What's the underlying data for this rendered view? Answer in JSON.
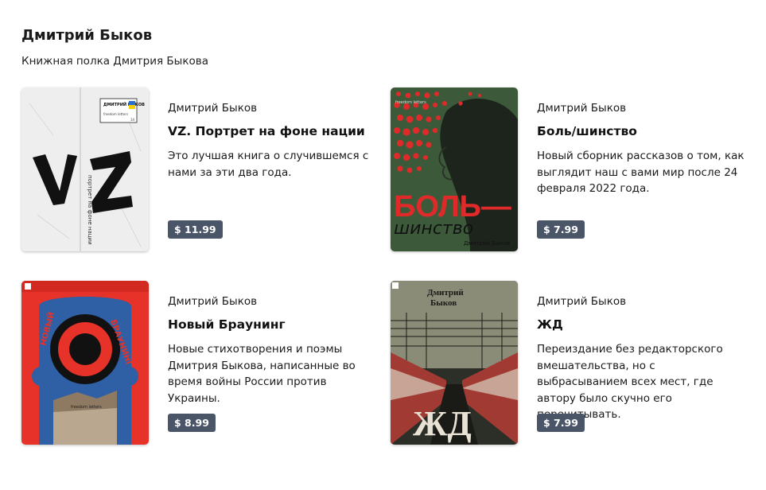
{
  "page": {
    "title": "Дмитрий Быков",
    "subtitle": "Книжная полка Дмитрия Быкова"
  },
  "books": [
    {
      "author": "Дмитрий Быков",
      "title": "VZ. Портрет на фоне нации",
      "description": "Это лучшая книга о случившемся с нами за эти два года.",
      "price": "$ 11.99",
      "cover_text": [
        "VZ",
        "ДМИТРИЙ БЫКОВ",
        "freedom letters",
        "портрет на фоне нации",
        "34"
      ]
    },
    {
      "author": "Дмитрий Быков",
      "title": "Боль/шинство",
      "description": "Новый сборник рассказов о том, как выглядит наш с вами мир после 24 февраля 2022 года.",
      "price": "$ 7.99",
      "cover_text": [
        "БОЛЬ—",
        "шинство",
        "Дмитрий Быков",
        "freedom letters"
      ]
    },
    {
      "author": "Дмитрий Быков",
      "title": "Новый Браунинг",
      "description": "Новые стихотворения и поэмы Дмитрия Быкова, написанные во время войны России против Украины.",
      "price": "$ 8.99",
      "cover_text": [
        "НОВЫЙ",
        "БРАУНИНГ",
        "freedom letters"
      ]
    },
    {
      "author": "Дмитрий Быков",
      "title": "ЖД",
      "description": "Переиздание без редакторского вмешательства, но с выбрасыванием всех мест, где автору было скучно его перечитывать.",
      "price": "$ 7.99",
      "cover_text": [
        "Дмитрий",
        "Быков",
        "ЖД"
      ]
    }
  ],
  "colors": {
    "price_badge": "#4a5668",
    "cover_red": "#e63228",
    "cover_green": "#3c5a3a"
  }
}
